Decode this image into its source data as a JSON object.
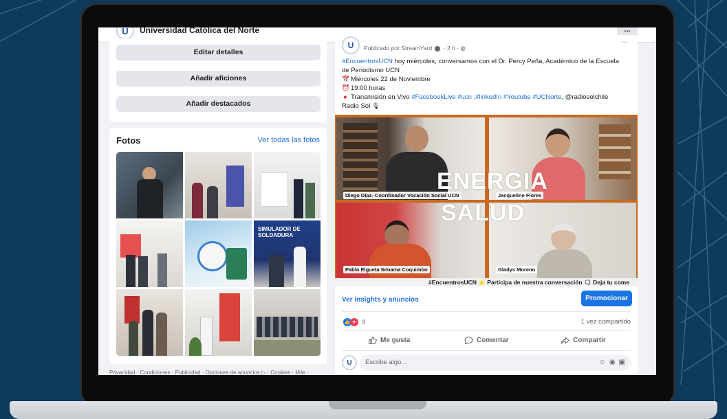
{
  "header": {
    "page_name": "Universidad Católica del Norte",
    "logo_letter": "U",
    "more_label": "..."
  },
  "profile_actions": {
    "edit_details": "Editar detalles",
    "add_hobbies": "Añadir aficiones",
    "add_featured": "Añadir destacados"
  },
  "photos": {
    "title": "Fotos",
    "see_all": "Ver todas las fotos"
  },
  "footer": {
    "links": "Privacidad · Condiciones · Publicidad · Opciones de anuncios ▷ · Cookies · Más ·"
  },
  "post": {
    "avatar_letter": "U",
    "published_by": "Publicado por StreamYard",
    "time": "2 h",
    "dots": "...",
    "text": {
      "hashtag_lead": "#EncuentrosUCN",
      "line1_rest": " hoy miércoles, conversamos con el Dr. Percy Peña, Académico de la Escuela",
      "line2": "de Periodismo UCN",
      "date": "Miércoles 22 de Noviembre",
      "time": "19:00 horas",
      "stream_prefix": "Transmisión en Vivo",
      "tag_facebook": "#FacebookLive",
      "tag_ucn": "#ucn",
      "tag_linkedin": ",#linkedIn",
      "tag_youtube": "#Youtube",
      "tag_ucnorte": "#UCNorte",
      "stream_suffix": ", @radiosolchile",
      "last_line": "Radio Sol"
    },
    "video": {
      "speaker_1": "Diego Díaz- Coordinador Vocación Social UCN",
      "speaker_2": "Jacqueline Flores",
      "speaker_3": "Pablo Elgueta Senama Coquimbo",
      "speaker_4": "Gladys Moreno",
      "overlay_1": "ENERGIA",
      "overlay_2": "SALUD",
      "ticker": "#EncuentrosUCN ⭐ Participa de nuestra conversación 🗨 Deja tu come"
    },
    "insights_link": "Ver insights y anuncios",
    "promote_button": "Promocionar",
    "reaction_count": "3",
    "shares": "1 vez compartido",
    "like_label": "Me gusta",
    "comment_label": "Comentar",
    "share_label": "Compartir",
    "comment_placeholder": "Escribe algo..."
  },
  "colors": {
    "background": "#0e3a5c",
    "link_blue": "#216fdb",
    "promote_blue": "#1b74e4",
    "video_frame": "#c86a23"
  }
}
